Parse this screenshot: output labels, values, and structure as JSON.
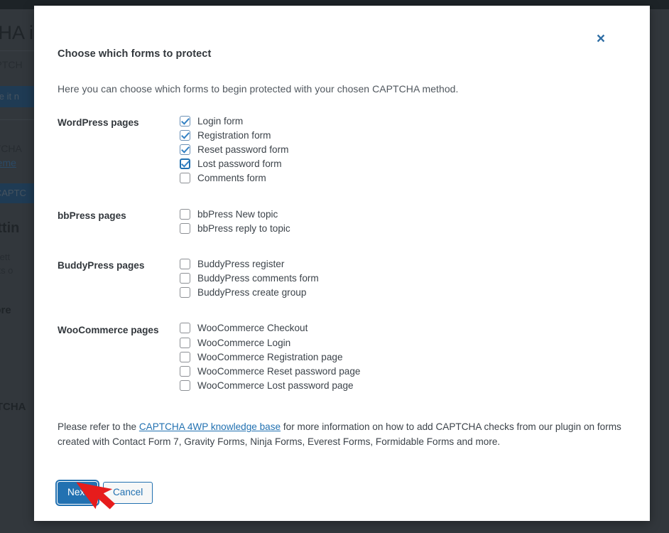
{
  "background": {
    "heading": "CHA i",
    "paragraph1": "CAPTCH",
    "button1": "gure it n",
    "paragraph2": "APTCHA",
    "link1": "placeme",
    "button2": "e CAPTC",
    "heading2": "settin",
    "paragraph3": "low sett",
    "paragraph4": "spects o",
    "heading3": "Score",
    "heading4": "APTCHA"
  },
  "modal": {
    "close_label": "×",
    "title": "Choose which forms to protect",
    "description": "Here you can choose which forms to begin protected with your chosen CAPTCHA method.",
    "sections": [
      {
        "label": "WordPress pages",
        "options": [
          {
            "label": "Login form",
            "checked": true,
            "focused": false
          },
          {
            "label": "Registration form",
            "checked": true,
            "focused": false
          },
          {
            "label": "Reset password form",
            "checked": true,
            "focused": false
          },
          {
            "label": "Lost password form",
            "checked": true,
            "focused": true
          },
          {
            "label": "Comments form",
            "checked": false,
            "focused": false
          }
        ]
      },
      {
        "label": "bbPress pages",
        "options": [
          {
            "label": "bbPress New topic",
            "checked": false,
            "focused": false
          },
          {
            "label": "bbPress reply to topic",
            "checked": false,
            "focused": false
          }
        ]
      },
      {
        "label": "BuddyPress pages",
        "options": [
          {
            "label": "BuddyPress register",
            "checked": false,
            "focused": false
          },
          {
            "label": "BuddyPress comments form",
            "checked": false,
            "focused": false
          },
          {
            "label": "BuddyPress create group",
            "checked": false,
            "focused": false
          }
        ]
      },
      {
        "label": "WooCommerce pages",
        "options": [
          {
            "label": "WooCommerce Checkout",
            "checked": false,
            "focused": false
          },
          {
            "label": "WooCommerce Login",
            "checked": false,
            "focused": false
          },
          {
            "label": "WooCommerce Registration page",
            "checked": false,
            "focused": false
          },
          {
            "label": "WooCommerce Reset password page",
            "checked": false,
            "focused": false
          },
          {
            "label": "WooCommerce Lost password page",
            "checked": false,
            "focused": false
          }
        ]
      }
    ],
    "note": {
      "prefix": "Please refer to the ",
      "link_text": "CAPTCHA 4WP knowledge base",
      "suffix": " for more information on how to add CAPTCHA checks from our plugin on forms created with Contact Form 7, Gravity Forms, Ninja Forms, Everest Forms, Formidable Forms and more."
    },
    "buttons": {
      "next": "Next",
      "cancel": "Cancel"
    }
  },
  "colors": {
    "accent": "#2271b1",
    "checkbox_check": "#3582c4",
    "link": "#2271b1",
    "overlay": "#32373c",
    "annotation_arrow": "#e61c1c"
  },
  "annotation": {
    "arrow": "red-pointer-arrow"
  }
}
